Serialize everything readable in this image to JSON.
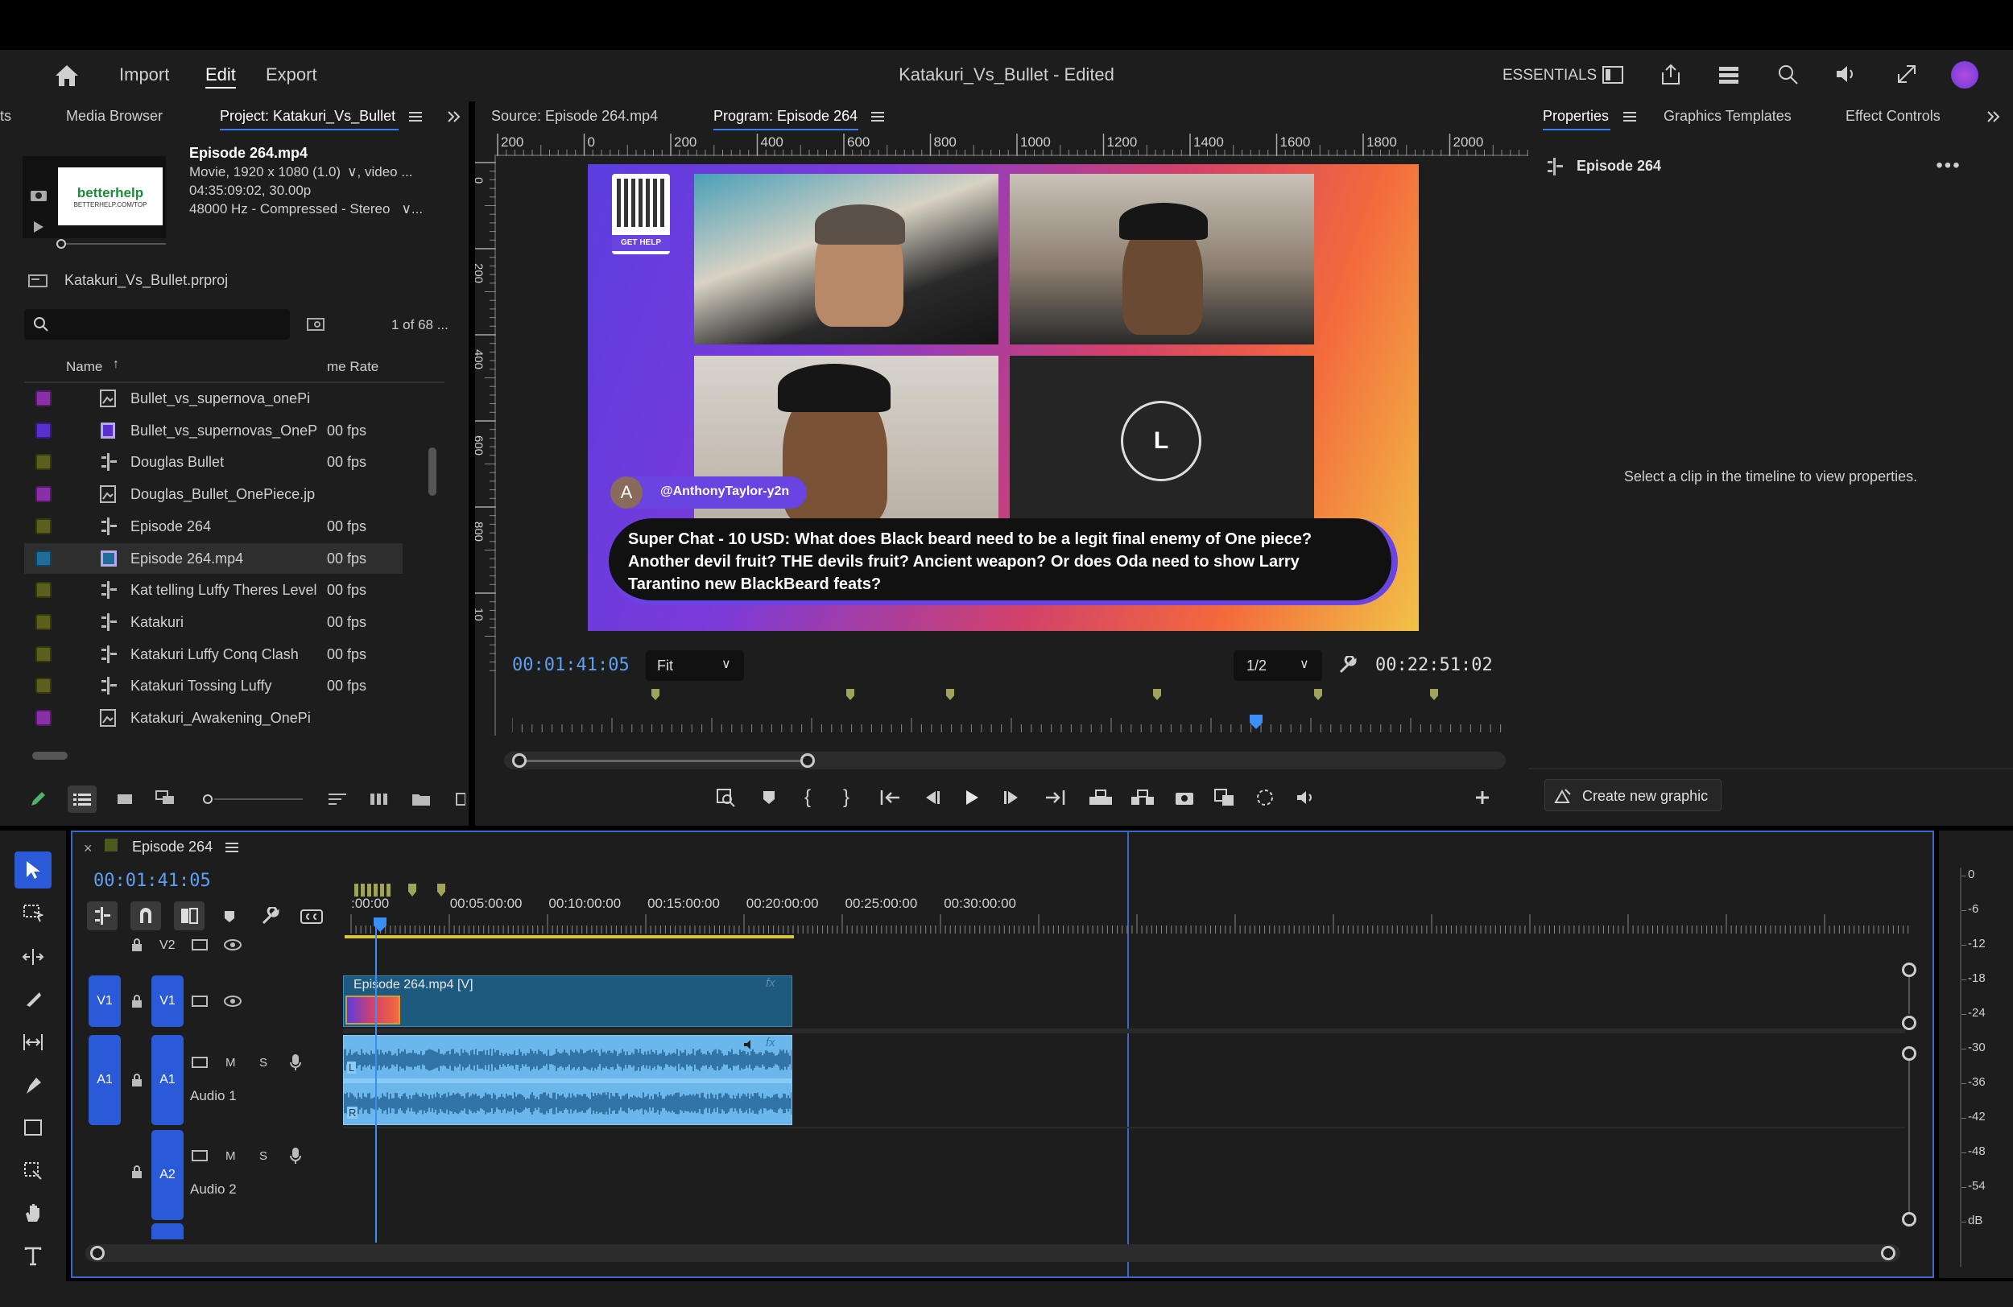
{
  "app": {
    "title": "Katakuri_Vs_Bullet",
    "title_suffix": " - Edited",
    "nav": {
      "import": "Import",
      "edit": "Edit",
      "export": "Export"
    },
    "workspace": "ESSENTIALS"
  },
  "project_panel": {
    "tabs": {
      "partial": "ts",
      "media_browser": "Media Browser",
      "project": "Project: Katakuri_Vs_Bullet"
    },
    "clip_name": "Episode 264.mp4",
    "clip_info_1": "Movie, 1920 x 1080 (1.0)",
    "clip_info_1b": ", video ...",
    "clip_info_2": "04:35:09:02, 30.00p",
    "clip_info_3": "48000 Hz - Compressed - Stereo",
    "thumb_text": "betterhelp",
    "thumb_subtext": "BETTERHELP.COM/TOP",
    "project_file": "Katakuri_Vs_Bullet.prproj",
    "item_count": "1 of 68 ...",
    "columns": {
      "name": "Name",
      "frame_rate": "me Rate"
    },
    "items": [
      {
        "name": "Bullet_vs_supernova_onePi",
        "fps": "",
        "color": "#8a2fa8",
        "icon": "image-icon"
      },
      {
        "name": "Bullet_vs_supernovas_OneP",
        "fps": "00 fps",
        "color": "#5a2fd0",
        "icon": "video-icon"
      },
      {
        "name": "Douglas Bullet",
        "fps": "00 fps",
        "color": "#5a5f1c",
        "icon": "sequence-icon"
      },
      {
        "name": "Douglas_Bullet_OnePiece.jp",
        "fps": "",
        "color": "#8a2fa8",
        "icon": "image-icon"
      },
      {
        "name": "Episode 264",
        "fps": "00 fps",
        "color": "#5a5f1c",
        "icon": "sequence-icon"
      },
      {
        "name": "Episode 264.mp4",
        "fps": "00 fps",
        "color": "#1f6e9a",
        "icon": "video-audio-icon"
      },
      {
        "name": "Kat telling Luffy Theres Level",
        "fps": "00 fps",
        "color": "#5a5f1c",
        "icon": "sequence-icon"
      },
      {
        "name": "Katakuri",
        "fps": "00 fps",
        "color": "#5a5f1c",
        "icon": "sequence-icon"
      },
      {
        "name": "Katakuri Luffy Conq Clash",
        "fps": "00 fps",
        "color": "#5a5f1c",
        "icon": "sequence-icon"
      },
      {
        "name": "Katakuri Tossing Luffy",
        "fps": "00 fps",
        "color": "#5a5f1c",
        "icon": "sequence-icon"
      },
      {
        "name": "Katakuri_Awakening_OnePi",
        "fps": "",
        "color": "#8a2fa8",
        "icon": "image-icon"
      }
    ]
  },
  "monitor": {
    "source_tab": "Source: Episode 264.mp4",
    "program_tab": "Program: Episode 264",
    "ruler_h": [
      "200",
      "0",
      "200",
      "400",
      "600",
      "800",
      "1000",
      "1200",
      "1400",
      "1600",
      "1800",
      "2000"
    ],
    "ruler_v": [
      "0",
      "200",
      "400",
      "600",
      "800",
      "10"
    ],
    "current_tc": "00:01:41:05",
    "zoom": "Fit",
    "resolution": "1/2",
    "duration_tc": "00:22:51:02",
    "overlay": {
      "qr_label": "GET HELP",
      "avatar_letter": "A",
      "username": "@AnthonyTaylor-y2n",
      "superchat": "Super Chat - 10 USD: What does Black beard need to be a legit final enemy of One piece? Another devil fruit? THE devils fruit? Ancient weapon? Or does Oda need to show Larry Tarantino new BlackBeard feats?",
      "placeholder_letter": "L"
    }
  },
  "properties": {
    "tabs": {
      "properties": "Properties",
      "graphics": "Graphics Templates",
      "effects": "Effect Controls"
    },
    "sequence": "Episode 264",
    "empty_msg": "Select a clip in the timeline to view properties.",
    "create_graphic": "Create new graphic"
  },
  "timeline": {
    "sequence_tab": "Episode 264",
    "timecode": "00:01:41:05",
    "ruler": [
      ":00:00",
      "00:05:00:00",
      "00:10:00:00",
      "00:15:00:00",
      "00:20:00:00",
      "00:25:00:00",
      "00:30:00:00"
    ],
    "tracks": {
      "v2": "V2",
      "v1": "V1",
      "a1": "A1",
      "a2": "A2",
      "audio1": "Audio 1",
      "audio2": "Audio 2",
      "m": "M",
      "s": "S"
    },
    "clip_video": "Episode 264.mp4 [V]",
    "fx": "fx",
    "ch_l": "L",
    "ch_r": "R"
  },
  "meter": {
    "labels": [
      "0",
      "-6",
      "-12",
      "-18",
      "-24",
      "-30",
      "-36",
      "-42",
      "-48",
      "-54",
      "dB"
    ]
  }
}
